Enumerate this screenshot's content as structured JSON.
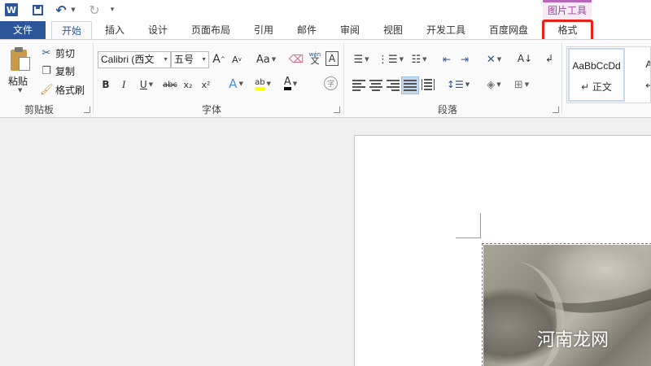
{
  "quick_access": {
    "app_icon_text": "W",
    "context_tab_group": "图片工具"
  },
  "tabs": {
    "file": "文件",
    "home": "开始",
    "insert": "插入",
    "design": "设计",
    "layout": "页面布局",
    "references": "引用",
    "mailings": "邮件",
    "review": "审阅",
    "view": "视图",
    "developer": "开发工具",
    "baidu_netdisk": "百度网盘",
    "format": "格式"
  },
  "clipboard": {
    "paste": "粘贴",
    "cut": "剪切",
    "copy": "复制",
    "format_painter": "格式刷",
    "group_label": "剪贴板"
  },
  "font": {
    "font_name": "Calibri (西文",
    "font_size": "五号",
    "grow": "A",
    "shrink": "A",
    "change_case": "Aa",
    "phonetic": "wén",
    "border_char": "A",
    "bold": "B",
    "italic": "I",
    "underline": "U",
    "strike": "abc",
    "subscript": "x₂",
    "superscript": "x²",
    "text_effect": "A",
    "highlight": "ab",
    "font_color": "A",
    "enclose": "字",
    "group_label": "字体",
    "highlight_color": "#ffff00",
    "font_color_value": "#000000"
  },
  "paragraph": {
    "group_label": "段落"
  },
  "styles": {
    "items": [
      {
        "sample": "AaBbCcDd",
        "name": "↵ 正文"
      },
      {
        "sample": "AaBl",
        "name": "↵ 无"
      }
    ]
  },
  "document": {
    "watermark": "河南龙网"
  },
  "colors": {
    "accent": "#2b579a",
    "context_accent": "#b868b8",
    "highlight_box": "#e8211b"
  }
}
